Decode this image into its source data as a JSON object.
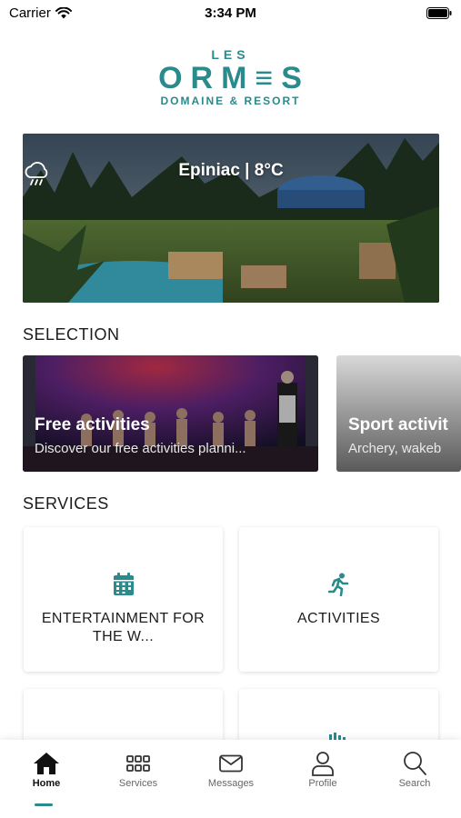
{
  "status_bar": {
    "carrier": "Carrier",
    "time": "3:34 PM"
  },
  "logo": {
    "les": "LES",
    "main": "ORM≡S",
    "sub": "DOMAINE & RESORT"
  },
  "hero": {
    "weather_icon": "cloud-rain-icon",
    "weather_text": "Epiniac | 8°C"
  },
  "selection": {
    "title": "SELECTION",
    "cards": [
      {
        "title": "Free activities",
        "description": "Discover our free activities planni..."
      },
      {
        "title": "Sport activit",
        "description": "Archery, wakeb"
      }
    ]
  },
  "services": {
    "title": "SERVICES",
    "cards": [
      {
        "label": "ENTERTAINMENT FOR THE W...",
        "icon": "calendar-icon"
      },
      {
        "label": "ACTIVITIES",
        "icon": "running-person-icon"
      },
      {
        "label": "",
        "icon": ""
      },
      {
        "label": "",
        "icon": "bar-chart-icon"
      }
    ]
  },
  "tab_bar": {
    "tabs": [
      {
        "label": "Home",
        "icon": "home-icon",
        "active": true
      },
      {
        "label": "Services",
        "icon": "grid-icon",
        "active": false
      },
      {
        "label": "Messages",
        "icon": "envelope-icon",
        "active": false
      },
      {
        "label": "Profile",
        "icon": "person-icon",
        "active": false
      },
      {
        "label": "Search",
        "icon": "search-icon",
        "active": false
      }
    ]
  },
  "colors": {
    "accent": "#2a8a8c",
    "text": "#1c1c1c",
    "tab_inactive": "#666666"
  }
}
